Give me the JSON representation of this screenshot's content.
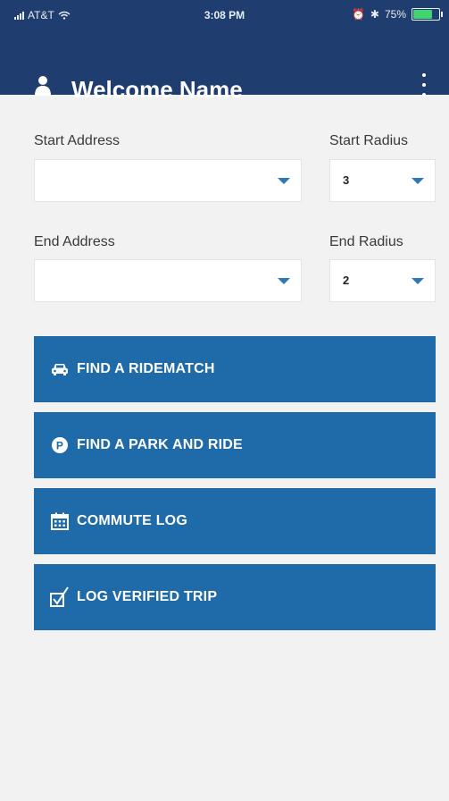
{
  "status_bar": {
    "carrier": "AT&T",
    "time": "3:08 PM",
    "battery_pct": "75%",
    "battery_fraction": 0.75,
    "battery_color": "#42d46b"
  },
  "header": {
    "title": "Welcome Name",
    "user_icon": "user-icon",
    "menu_icon": "more-vertical-icon",
    "bg_color": "#1f3d6e"
  },
  "form": {
    "start_address_label": "Start Address",
    "start_address_value": "",
    "start_radius_label": "Start Radius",
    "start_radius_value": "3",
    "end_address_label": "End Address",
    "end_address_value": "",
    "end_radius_label": "End Radius",
    "end_radius_value": "2"
  },
  "actions": [
    {
      "label": "FIND A RIDEMATCH",
      "icon": "car-icon"
    },
    {
      "label": "FIND A PARK AND RIDE",
      "icon": "parking-icon"
    },
    {
      "label": "COMMUTE LOG",
      "icon": "calendar-icon"
    },
    {
      "label": "LOG VERIFIED TRIP",
      "icon": "checkbox-icon"
    }
  ],
  "colors": {
    "accent": "#1f6aa8",
    "caret": "#2f78b8",
    "background": "#f2f2f2"
  }
}
